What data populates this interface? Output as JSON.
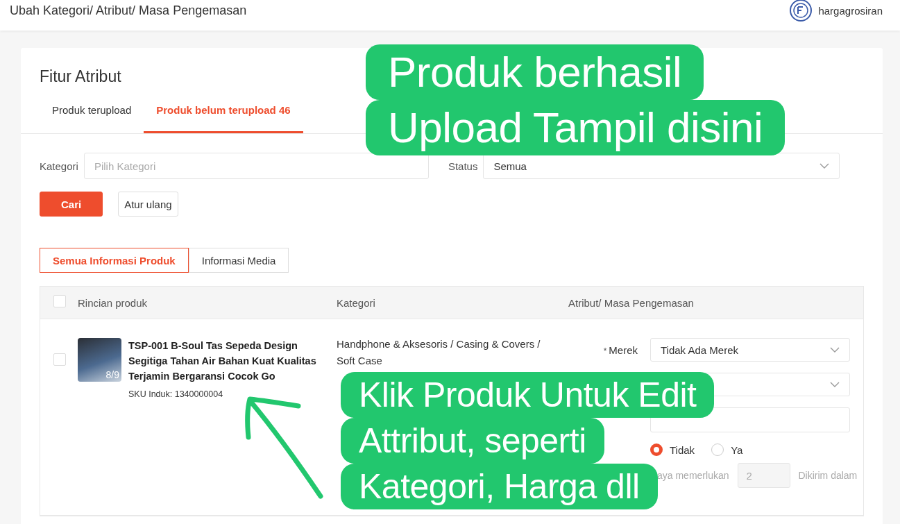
{
  "header": {
    "title": "Ubah Kategori/ Atribut/ Masa Pengemasan",
    "account": "hargagrosiran"
  },
  "card": {
    "title": "Fitur Atribut",
    "tabs": [
      {
        "label": "Produk terupload",
        "selected": false
      },
      {
        "label": "Produk belum terupload 46",
        "selected": true
      }
    ],
    "filters": [
      {
        "label": "Kategori",
        "placeholder": "Pilih Kategori",
        "kind": "input"
      },
      {
        "label": "Status",
        "value": "Semua",
        "kind": "select"
      }
    ],
    "buttons": [
      {
        "label": "Cari",
        "kind": "primary"
      },
      {
        "label": "Atur ulang",
        "kind": "secondary"
      }
    ],
    "view_tabs": [
      {
        "label": "Semua Informasi Produk",
        "selected": true
      },
      {
        "label": "Informasi Media",
        "selected": false
      }
    ],
    "table": {
      "all_checked": false,
      "columns": [
        "Rincian produk",
        "Kategori",
        "Atribut/ Masa Pengemasan"
      ],
      "rows": [
        {
          "checked": false,
          "name": "TSP-001 B-Soul Tas Sepeda Design Segitiga Tahan Air Bahan Kuat Kualitas Terjamin Bergaransi Cocok Go",
          "sku": "SKU Induk: 1340000004",
          "image_count": "8/9",
          "category": "Handphone & Aksesoris / Casing & Covers / Soft Case",
          "attributes": [
            {
              "kind": "select",
              "label": "Merek",
              "required_mark": "*",
              "value": "Tidak Ada Merek"
            },
            {
              "kind": "select"
            },
            {
              "kind": "input"
            },
            {
              "kind": "radio",
              "options": [
                {
                  "label": "Tidak",
                  "selected": true
                },
                {
                  "label": "Ya",
                  "selected": false
                }
              ]
            }
          ],
          "preorder": {
            "label": "aya memerlukan",
            "value": "2",
            "suffix": "Dikirim dalam"
          }
        }
      ]
    }
  },
  "annotations": [
    {
      "lines": [
        "Produk berhasil",
        "Upload Tampil disini"
      ]
    },
    {
      "lines": [
        "Klik Produk Untuk Edit",
        "Attribut, seperti",
        "Kategori, Harga dll"
      ]
    }
  ]
}
